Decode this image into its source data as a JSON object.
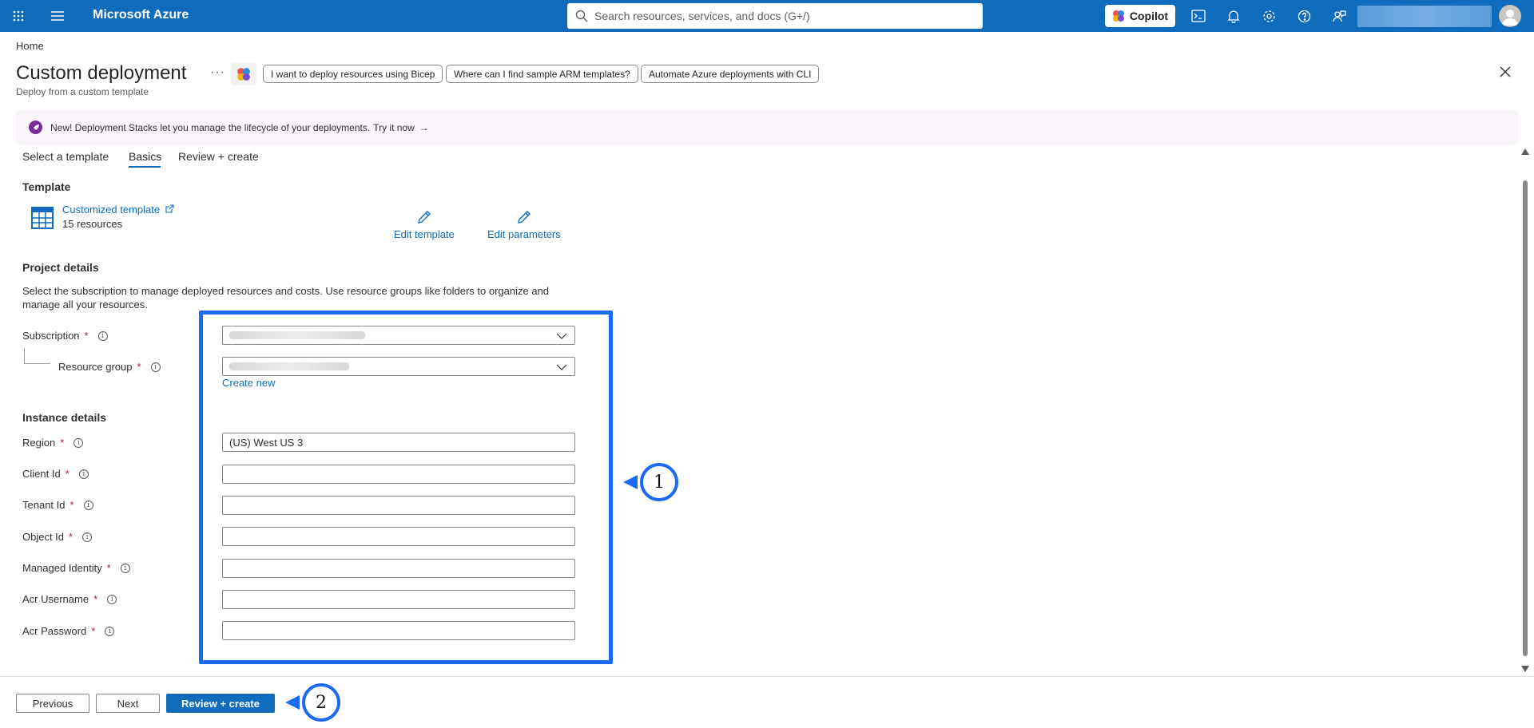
{
  "topbar": {
    "brand": "Microsoft Azure",
    "search_placeholder": "Search resources, services, and docs (G+/)",
    "copilot_label": "Copilot",
    "accent_color": "#0f6cbd"
  },
  "breadcrumb": "Home",
  "header": {
    "title": "Custom deployment",
    "subtitle": "Deploy from a custom template",
    "ellipsis": "···",
    "chips": [
      "I want to deploy resources using Bicep",
      "Where can I find sample ARM templates?",
      "Automate Azure deployments with CLI"
    ]
  },
  "banner": {
    "text": "New! Deployment Stacks let you manage the lifecycle of your deployments.",
    "link": "Try it now",
    "arrow": "→"
  },
  "tabs": [
    "Select a template",
    "Basics",
    "Review + create"
  ],
  "active_tab": "Basics",
  "template": {
    "heading": "Template",
    "name": "Customized template",
    "resources": "15 resources",
    "edit_template": "Edit template",
    "edit_parameters": "Edit parameters"
  },
  "project": {
    "heading": "Project details",
    "description": "Select the subscription to manage deployed resources and costs. Use resource groups like folders to organize and manage all your resources.",
    "subscription_label": "Subscription",
    "resource_group_label": "Resource group",
    "create_new": "Create new"
  },
  "instance": {
    "heading": "Instance details",
    "region_label": "Region",
    "region_value": "(US) West US 3",
    "client_id_label": "Client Id",
    "tenant_id_label": "Tenant Id",
    "object_id_label": "Object Id",
    "managed_identity_label": "Managed Identity",
    "acr_username_label": "Acr Username",
    "acr_password_label": "Acr Password"
  },
  "required_mark": "*",
  "info_glyph": "i",
  "annotations": {
    "callout_1": "1",
    "callout_2": "2",
    "highlight_color": "#1a6bf0"
  },
  "footer": {
    "previous": "Previous",
    "next": "Next",
    "review_create": "Review + create"
  }
}
